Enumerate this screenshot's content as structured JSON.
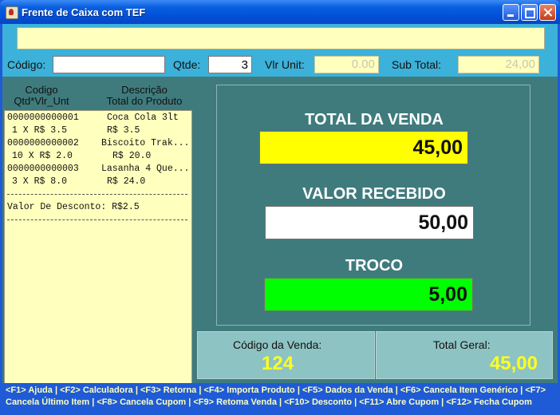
{
  "window": {
    "title": "Frente de Caixa com TEF"
  },
  "form": {
    "codigo_label": "Código:",
    "codigo_value": "",
    "qtde_label": "Qtde:",
    "qtde_value": "3",
    "vlr_unit_label": "Vlr Unit:",
    "vlr_unit_value": "0.00",
    "sub_total_label": "Sub Total:",
    "sub_total_value": "24,00"
  },
  "list": {
    "header_col1_line1": "Codigo",
    "header_col1_line2": "Qtd*Vlr_Unt",
    "header_col2_line1": "Descrição",
    "header_col2_line2": "Total do Produto",
    "items": [
      {
        "code": "0000000000001",
        "desc": "Coca Cola 3lt",
        "qty_line": "1 X R$ 3.5",
        "total": "R$ 3.5"
      },
      {
        "code": "0000000000002",
        "desc": "Biscoito Trak...",
        "qty_line": "10 X R$ 2.0",
        "total": "R$ 20.0"
      },
      {
        "code": "0000000000003",
        "desc": "Lasanha 4 Que...",
        "qty_line": "3 X R$ 8.0",
        "total": "R$ 24.0"
      }
    ],
    "desconto": "Valor De Desconto: R$2.5"
  },
  "totals": {
    "total_venda_label": "TOTAL DA VENDA",
    "total_venda_value": "45,00",
    "valor_recebido_label": "VALOR RECEBIDO",
    "valor_recebido_value": "50,00",
    "troco_label": "TROCO",
    "troco_value": "5,00"
  },
  "info": {
    "codigo_venda_label": "Código da Venda:",
    "codigo_venda_value": "124",
    "total_geral_label": "Total Geral:",
    "total_geral_value": "45,00"
  },
  "footer": {
    "line1": "<F1> Ajuda | <F2> Calculadora | <F3> Retorna | <F4> Importa Produto | <F5> Dados da Venda | <F6> Cancela Item Genérico | <F7>",
    "line2": "Cancela Último Item | <F8> Cancela Cupom | <F9> Retoma Venda | <F10> Desconto | <F11> Abre Cupom | <F12> Fecha Cupom"
  },
  "colors": {
    "total_venda_bg": "#ffff00",
    "valor_recebido_bg": "#ffffff",
    "troco_bg": "#00ff00",
    "info_value": "#ffff1d"
  }
}
